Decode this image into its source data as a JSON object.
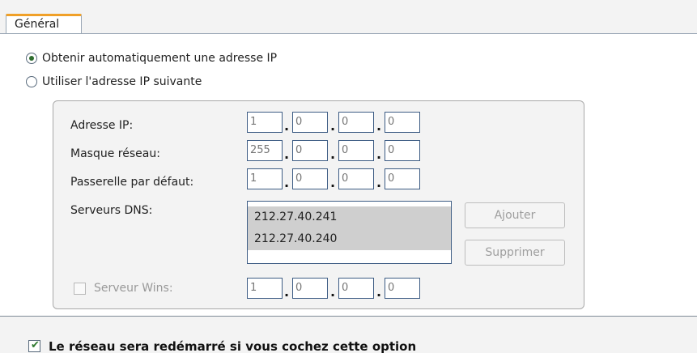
{
  "tab": {
    "label": "Général"
  },
  "radio_auto": {
    "label": "Obtenir automatiquement une adresse IP",
    "checked": true
  },
  "radio_manual": {
    "label": "Utiliser l'adresse IP suivante",
    "checked": false
  },
  "ip_address": {
    "label": "Adresse IP:",
    "octets": [
      "1",
      "0",
      "0",
      "0"
    ]
  },
  "netmask": {
    "label": "Masque réseau:",
    "octets": [
      "255",
      "0",
      "0",
      "0"
    ]
  },
  "gateway": {
    "label": "Passerelle par défaut:",
    "octets": [
      "1",
      "0",
      "0",
      "0"
    ]
  },
  "dns": {
    "label": "Serveurs DNS:",
    "servers": [
      "212.27.40.241",
      "212.27.40.240"
    ],
    "add_label": "Ajouter",
    "remove_label": "Supprimer"
  },
  "wins": {
    "label": "Serveur Wins:",
    "checked": false,
    "octets": [
      "1",
      "0",
      "0",
      "0"
    ]
  },
  "restart_option": {
    "label": "Le réseau sera redémarré si vous cochez cette option",
    "checked": true
  },
  "colors": {
    "tab_accent": "#f0a028",
    "field_border": "#3d5c84",
    "radio_dot": "#2e6d2e",
    "disabled_text": "#9e9e9e"
  }
}
